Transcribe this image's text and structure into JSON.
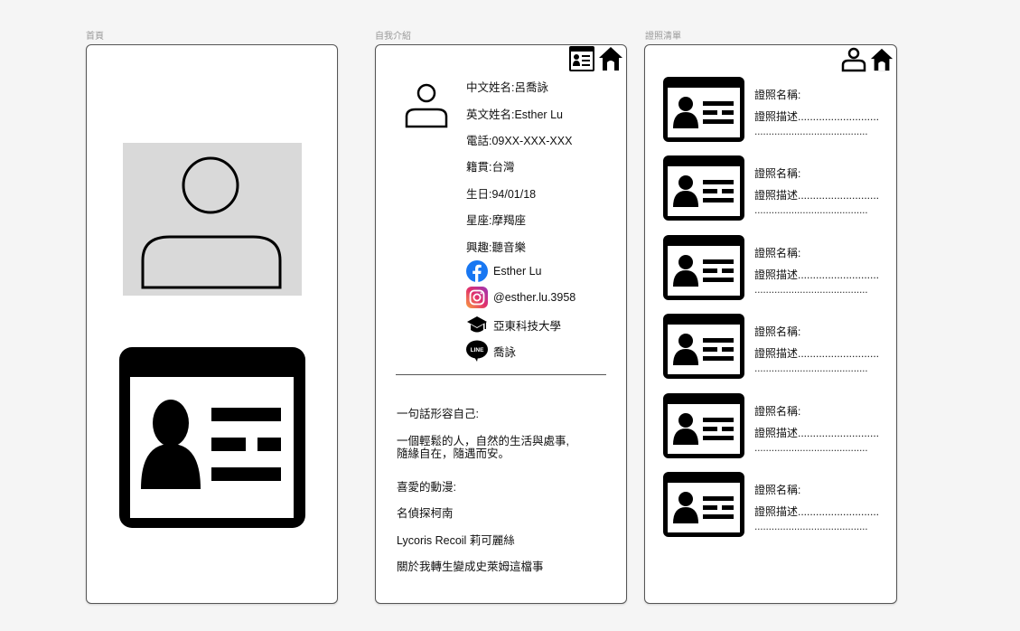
{
  "frames": {
    "home": {
      "label": "首頁"
    },
    "intro": {
      "label": "自我介紹"
    },
    "certs": {
      "label": "證照清單"
    }
  },
  "intro": {
    "fields": [
      "中文姓名:呂喬詠",
      "英文姓名:Esther Lu",
      "電話:09XX-XXX-XXX",
      "籍貫:台灣",
      "生日:94/01/18",
      "星座:摩羯座",
      "興趣:聽音樂"
    ],
    "social": {
      "facebook": "Esther Lu",
      "instagram": "@esther.lu.3958",
      "school": "亞東科技大學",
      "line": "喬詠"
    },
    "self_desc_title": "一句話形容自己:",
    "self_desc_line1": "一個輕鬆的人，自然的生活與處事,",
    "self_desc_line2": "隨緣自在，隨遇而安。",
    "anime_title": "喜愛的動漫:",
    "anime": [
      "名偵探柯南",
      "Lycoris Recoil 莉可麗絲",
      "關於我轉生變成史萊姆這檔事"
    ]
  },
  "certs": {
    "name_label": "證照名稱:",
    "desc_label": "證照描述...........................",
    "desc_line2": "........................................",
    "count_items": [
      1,
      2,
      3,
      4,
      5,
      6
    ]
  },
  "colors": {
    "facebook": "#1877f2",
    "instagram_start": "#f9a03f",
    "instagram_end": "#9b36b7",
    "placeholder_gray": "#d9d9d9"
  },
  "icons": [
    "user-icon",
    "id-card-icon",
    "home-icon",
    "facebook-icon",
    "instagram-icon",
    "graduation-cap-icon",
    "line-icon"
  ]
}
